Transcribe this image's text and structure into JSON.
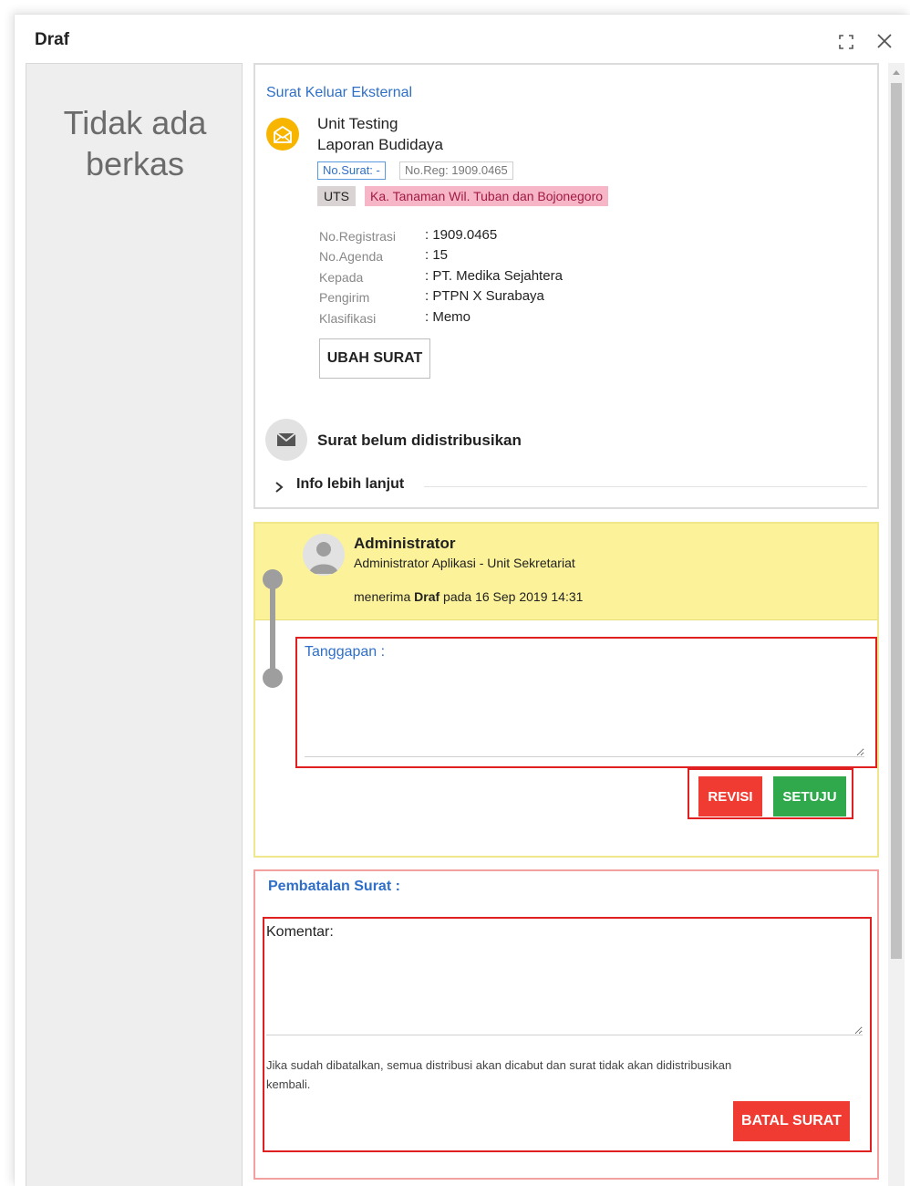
{
  "dialog": {
    "title": "Draf"
  },
  "sidebar": {
    "empty_line1": "Tidak ada",
    "empty_line2": "berkas"
  },
  "letter": {
    "type_link": "Surat Keluar Eksternal",
    "unit": "Unit Testing",
    "subject": "Laporan Budidaya",
    "badge_no_surat": "No.Surat: -",
    "badge_no_reg": "No.Reg: 1909.0465",
    "tag_code": "UTS",
    "tag_position": "Ka. Tanaman Wil. Tuban dan Bojonegoro",
    "meta": [
      {
        "label": "No.Registrasi",
        "value": ": 1909.0465"
      },
      {
        "label": "No.Agenda",
        "value": ": 15"
      },
      {
        "label": "Kepada",
        "value": ": PT. Medika Sejahtera"
      },
      {
        "label": "Pengirim",
        "value": ": PTPN X Surabaya"
      },
      {
        "label": "Klasifikasi",
        "value": ": Memo"
      }
    ],
    "edit_button": "UBAH SURAT",
    "distribution_status": "Surat belum didistribusikan",
    "more_info": "Info lebih lanjut"
  },
  "timeline": {
    "name": "Administrator",
    "role": "Administrator Aplikasi - Unit Sekretariat",
    "action_pre": "menerima ",
    "action_bold": "Draf",
    "action_post": " pada 16 Sep 2019 14:31",
    "response_label": "Tanggapan :",
    "revise_button": "REVISI",
    "approve_button": "SETUJU"
  },
  "cancellation": {
    "title": "Pembatalan Surat :",
    "comment_label": "Komentar:",
    "warning_line1": "Jika sudah dibatalkan, semua distribusi akan dicabut dan surat tidak akan didistribusikan",
    "warning_line2": "kembali.",
    "cancel_button": "BATAL SURAT"
  },
  "colors": {
    "accent_blue": "#2f6fc7",
    "danger_red": "#ef3b32",
    "success_green": "#2fa94b",
    "highlight_yellow": "#fbf29a",
    "tag_pink": "#f6b6c8",
    "icon_yellow": "#f7b500"
  },
  "icons": [
    "maximize-icon",
    "close-icon",
    "mail-open-icon",
    "envelope-icon",
    "chevron-right-icon",
    "user-avatar-icon"
  ]
}
